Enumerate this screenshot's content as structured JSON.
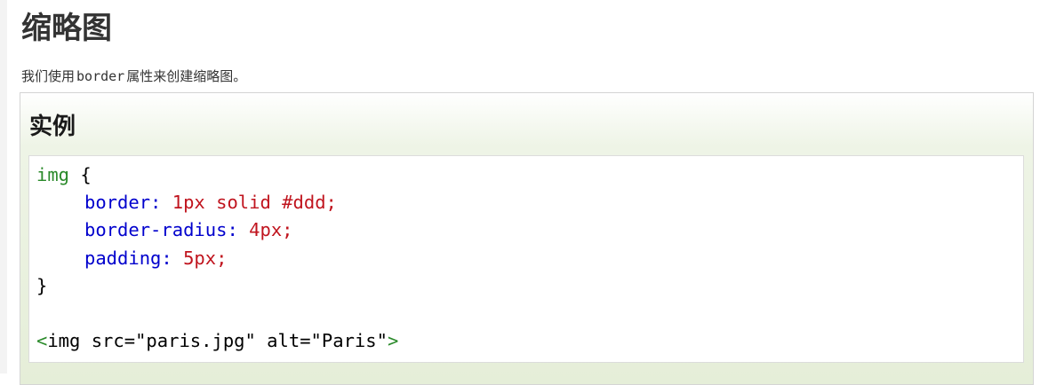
{
  "page": {
    "title": "缩略图",
    "intro_before": "我们使用",
    "intro_code": "border",
    "intro_after": "属性来创建缩略图。"
  },
  "example": {
    "heading": "实例",
    "code": {
      "line1_selector": "img",
      "line1_brace": " {",
      "line2_prop": "border:",
      "line2_val": " 1px solid #ddd;",
      "line3_prop": "border-radius:",
      "line3_val": " 4px;",
      "line4_prop": "padding:",
      "line4_val": " 5px;",
      "line5_brace": "}",
      "line7_open": "<",
      "line7_text": "img src=\"paris.jpg\" alt=\"Paris\"",
      "line7_close": ">"
    }
  }
}
